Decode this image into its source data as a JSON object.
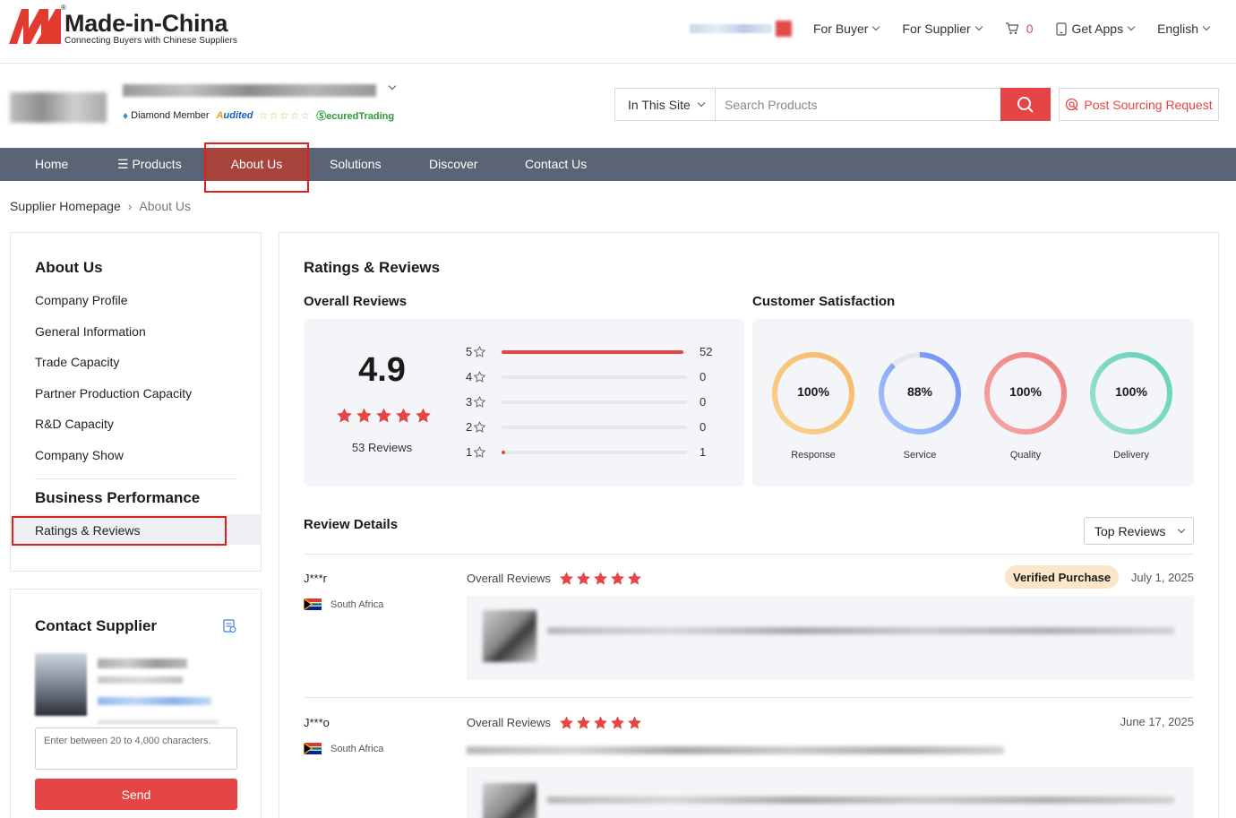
{
  "header": {
    "logo_title": "Made-in-China",
    "logo_subtitle": "Connecting Buyers with Chinese Suppliers",
    "nav": {
      "for_buyer": "For Buyer",
      "for_supplier": "For Supplier",
      "cart_count": "0",
      "get_apps": "Get Apps",
      "language": "English"
    }
  },
  "company": {
    "member_level": "Diamond Member",
    "audited": "udited",
    "secured": "ecuredTrading",
    "search": {
      "scope": "In This Site",
      "placeholder": "Search Products"
    },
    "post_sourcing": "Post Sourcing Request"
  },
  "main_nav": {
    "items": [
      "Home",
      "Products",
      "About Us",
      "Solutions",
      "Discover",
      "Contact Us"
    ],
    "active": "About Us"
  },
  "breadcrumb": {
    "home": "Supplier Homepage",
    "current": "About Us"
  },
  "sidebar": {
    "about_title": "About Us",
    "about_items": [
      "Company Profile",
      "General Information",
      "Trade Capacity",
      "Partner Production Capacity",
      "R&D Capacity",
      "Company Show"
    ],
    "business_title": "Business Performance",
    "business_items": [
      "Ratings & Reviews"
    ]
  },
  "contact": {
    "title": "Contact Supplier",
    "placeholder": "Enter between 20 to 4,000 characters.",
    "send": "Send"
  },
  "ratings": {
    "title": "Ratings & Reviews",
    "overall_title": "Overall Reviews",
    "score": "4.9",
    "review_count": "53 Reviews",
    "star_filled": 5,
    "distribution": [
      {
        "stars": "5",
        "count": "52",
        "fraction": 0.98
      },
      {
        "stars": "4",
        "count": "0",
        "fraction": 0
      },
      {
        "stars": "3",
        "count": "0",
        "fraction": 0
      },
      {
        "stars": "2",
        "count": "0",
        "fraction": 0
      },
      {
        "stars": "1",
        "count": "1",
        "fraction": 0.02
      }
    ],
    "satisfaction_title": "Customer Satisfaction",
    "satisfaction": [
      {
        "label": "Response",
        "value": "100%",
        "fraction": 1.0,
        "color_a": "#f6b86a",
        "color_b": "#f9d38e"
      },
      {
        "label": "Service",
        "value": "88%",
        "fraction": 0.88,
        "color_a": "#6f8ff2",
        "color_b": "#a8c6fb"
      },
      {
        "label": "Quality",
        "value": "100%",
        "fraction": 1.0,
        "color_a": "#f07d7d",
        "color_b": "#f6a6a6"
      },
      {
        "label": "Delivery",
        "value": "100%",
        "fraction": 1.0,
        "color_a": "#5fd0b7",
        "color_b": "#9ee3d1"
      }
    ]
  },
  "review_details": {
    "title": "Review Details",
    "sort": "Top Reviews",
    "reviews": [
      {
        "name": "J***r",
        "country": "South Africa",
        "label": "Overall Reviews",
        "verified": "Verified Purchase",
        "date": "July 1, 2025"
      },
      {
        "name": "J***o",
        "country": "South Africa",
        "label": "Overall Reviews",
        "date": "June 17, 2025"
      }
    ]
  },
  "colors": {
    "accent": "#e64545",
    "nav_bg": "#5a6475",
    "nav_active": "#a8443c"
  }
}
